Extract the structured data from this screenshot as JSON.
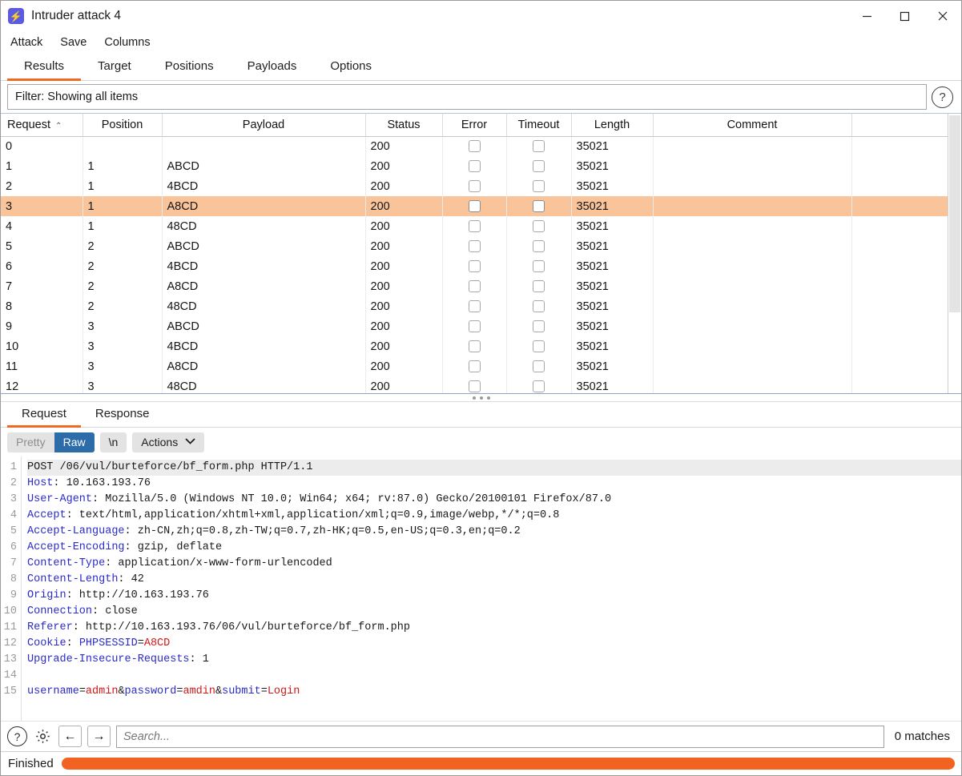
{
  "window": {
    "title": "Intruder attack 4",
    "icon": "lightning-bolt-icon",
    "minimize": "—",
    "maximize": "□",
    "close": "✕"
  },
  "menubar": {
    "items": [
      "Attack",
      "Save",
      "Columns"
    ]
  },
  "tabs": {
    "items": [
      "Results",
      "Target",
      "Positions",
      "Payloads",
      "Options"
    ],
    "active": "Results"
  },
  "filter": {
    "text": "Filter: Showing all items",
    "help_label": "?"
  },
  "table": {
    "columns": [
      "Request",
      "Position",
      "Payload",
      "Status",
      "Error",
      "Timeout",
      "Length",
      "Comment"
    ],
    "sort_column": "Request",
    "sort_caret": "⌃",
    "selected_request": "3",
    "rows": [
      {
        "request": "0",
        "position": "",
        "payload": "",
        "status": "200",
        "error": false,
        "timeout": false,
        "length": "35021",
        "comment": ""
      },
      {
        "request": "1",
        "position": "1",
        "payload": "ABCD",
        "status": "200",
        "error": false,
        "timeout": false,
        "length": "35021",
        "comment": ""
      },
      {
        "request": "2",
        "position": "1",
        "payload": "4BCD",
        "status": "200",
        "error": false,
        "timeout": false,
        "length": "35021",
        "comment": ""
      },
      {
        "request": "3",
        "position": "1",
        "payload": "A8CD",
        "status": "200",
        "error": false,
        "timeout": false,
        "length": "35021",
        "comment": ""
      },
      {
        "request": "4",
        "position": "1",
        "payload": "48CD",
        "status": "200",
        "error": false,
        "timeout": false,
        "length": "35021",
        "comment": ""
      },
      {
        "request": "5",
        "position": "2",
        "payload": "ABCD",
        "status": "200",
        "error": false,
        "timeout": false,
        "length": "35021",
        "comment": ""
      },
      {
        "request": "6",
        "position": "2",
        "payload": "4BCD",
        "status": "200",
        "error": false,
        "timeout": false,
        "length": "35021",
        "comment": ""
      },
      {
        "request": "7",
        "position": "2",
        "payload": "A8CD",
        "status": "200",
        "error": false,
        "timeout": false,
        "length": "35021",
        "comment": ""
      },
      {
        "request": "8",
        "position": "2",
        "payload": "48CD",
        "status": "200",
        "error": false,
        "timeout": false,
        "length": "35021",
        "comment": ""
      },
      {
        "request": "9",
        "position": "3",
        "payload": "ABCD",
        "status": "200",
        "error": false,
        "timeout": false,
        "length": "35021",
        "comment": ""
      },
      {
        "request": "10",
        "position": "3",
        "payload": "4BCD",
        "status": "200",
        "error": false,
        "timeout": false,
        "length": "35021",
        "comment": ""
      },
      {
        "request": "11",
        "position": "3",
        "payload": "A8CD",
        "status": "200",
        "error": false,
        "timeout": false,
        "length": "35021",
        "comment": ""
      },
      {
        "request": "12",
        "position": "3",
        "payload": "48CD",
        "status": "200",
        "error": false,
        "timeout": false,
        "length": "35021",
        "comment": ""
      }
    ]
  },
  "message_tabs": {
    "items": [
      "Request",
      "Response"
    ],
    "active": "Request"
  },
  "editor_toolbar": {
    "pretty_label": "Pretty",
    "raw_label": "Raw",
    "newline_label": "\\n",
    "actions_label": "Actions",
    "actions_caret": "⌄",
    "active_view": "Raw"
  },
  "request": {
    "lines": [
      {
        "n": "1",
        "segments": [
          {
            "t": "POST /06/vul/burteforce/bf_form.php HTTP/1.1",
            "c": "val"
          }
        ],
        "highlight": true
      },
      {
        "n": "2",
        "segments": [
          {
            "t": "Host",
            "c": "hdr"
          },
          {
            "t": ": 10.163.193.76",
            "c": "val"
          }
        ]
      },
      {
        "n": "3",
        "segments": [
          {
            "t": "User-Agent",
            "c": "hdr"
          },
          {
            "t": ": Mozilla/5.0 (Windows NT 10.0; Win64; x64; rv:87.0) Gecko/20100101 Firefox/87.0",
            "c": "val"
          }
        ]
      },
      {
        "n": "4",
        "segments": [
          {
            "t": "Accept",
            "c": "hdr"
          },
          {
            "t": ": text/html,application/xhtml+xml,application/xml;q=0.9,image/webp,*/*;q=0.8",
            "c": "val"
          }
        ]
      },
      {
        "n": "5",
        "segments": [
          {
            "t": "Accept-Language",
            "c": "hdr"
          },
          {
            "t": ": zh-CN,zh;q=0.8,zh-TW;q=0.7,zh-HK;q=0.5,en-US;q=0.3,en;q=0.2",
            "c": "val"
          }
        ]
      },
      {
        "n": "6",
        "segments": [
          {
            "t": "Accept-Encoding",
            "c": "hdr"
          },
          {
            "t": ": gzip, deflate",
            "c": "val"
          }
        ]
      },
      {
        "n": "7",
        "segments": [
          {
            "t": "Content-Type",
            "c": "hdr"
          },
          {
            "t": ": application/x-www-form-urlencoded",
            "c": "val"
          }
        ]
      },
      {
        "n": "8",
        "segments": [
          {
            "t": "Content-Length",
            "c": "hdr"
          },
          {
            "t": ": 42",
            "c": "val"
          }
        ]
      },
      {
        "n": "9",
        "segments": [
          {
            "t": "Origin",
            "c": "hdr"
          },
          {
            "t": ": http://10.163.193.76",
            "c": "val"
          }
        ]
      },
      {
        "n": "10",
        "segments": [
          {
            "t": "Connection",
            "c": "hdr"
          },
          {
            "t": ": close",
            "c": "val"
          }
        ]
      },
      {
        "n": "11",
        "segments": [
          {
            "t": "Referer",
            "c": "hdr"
          },
          {
            "t": ": http://10.163.193.76/06/vul/burteforce/bf_form.php",
            "c": "val"
          }
        ]
      },
      {
        "n": "12",
        "segments": [
          {
            "t": "Cookie",
            "c": "hdr"
          },
          {
            "t": ": ",
            "c": "val"
          },
          {
            "t": "PHPSESSID",
            "c": "blue"
          },
          {
            "t": "=",
            "c": "val"
          },
          {
            "t": "A8CD",
            "c": "red"
          }
        ]
      },
      {
        "n": "13",
        "segments": [
          {
            "t": "Upgrade-Insecure-Requests",
            "c": "hdr"
          },
          {
            "t": ": 1",
            "c": "val"
          }
        ]
      },
      {
        "n": "14",
        "segments": [
          {
            "t": "",
            "c": "val"
          }
        ]
      },
      {
        "n": "15",
        "segments": [
          {
            "t": "username",
            "c": "blue"
          },
          {
            "t": "=",
            "c": "val"
          },
          {
            "t": "admin",
            "c": "red"
          },
          {
            "t": "&",
            "c": "val"
          },
          {
            "t": "password",
            "c": "blue"
          },
          {
            "t": "=",
            "c": "val"
          },
          {
            "t": "amdin",
            "c": "red"
          },
          {
            "t": "&",
            "c": "val"
          },
          {
            "t": "submit",
            "c": "blue"
          },
          {
            "t": "=",
            "c": "val"
          },
          {
            "t": "Login",
            "c": "red"
          }
        ]
      }
    ]
  },
  "search": {
    "help_label": "?",
    "gear": "gear-icon",
    "prev_label": "←",
    "next_label": "→",
    "placeholder": "Search...",
    "matches": "0 matches"
  },
  "status": {
    "text": "Finished",
    "progress_percent": 100,
    "progress_color": "#f26322"
  }
}
